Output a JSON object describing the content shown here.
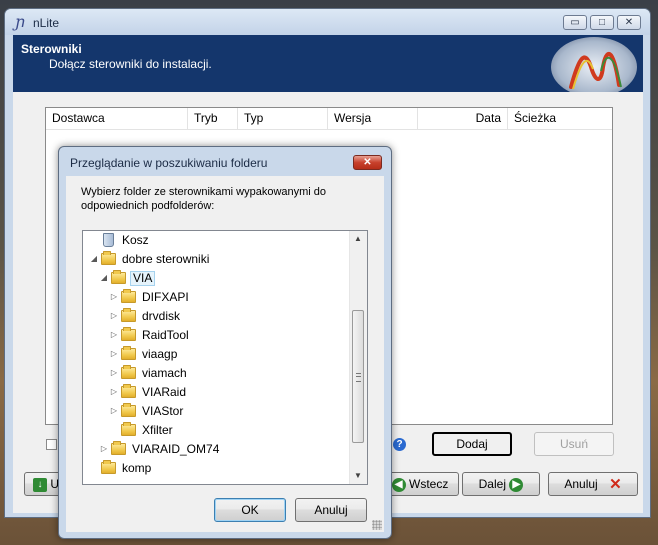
{
  "window": {
    "title": "nLite",
    "app_icon": "nlite-logo-icon",
    "controls": {
      "minimize": "▭",
      "maximize": "□",
      "close": "✕"
    }
  },
  "header": {
    "title": "Sterowniki",
    "subtitle": "Dołącz sterowniki do instalacji."
  },
  "driver_list": {
    "columns": [
      "Dostawca",
      "Tryb",
      "Typ",
      "Wersja",
      "Data",
      "Ścieżka"
    ],
    "rows": []
  },
  "buttons": {
    "add": "Dodaj",
    "remove": "Usuń",
    "help_icon": "?"
  },
  "footer": {
    "left_label": "U",
    "back": "Wstecz",
    "next": "Dalej",
    "cancel": "Anuluj"
  },
  "dialog": {
    "title": "Przeglądanie w poszukiwaniu folderu",
    "close_glyph": "✕",
    "description": "Wybierz folder ze sterownikami wypakowanymi do odpowiednich podfolderów:",
    "tree": [
      {
        "label": "Kosz",
        "icon": "recycle-bin-icon",
        "level": 1,
        "expander": ""
      },
      {
        "label": "dobre sterowniki",
        "icon": "folder-icon",
        "level": 1,
        "expander": "◢"
      },
      {
        "label": "VIA",
        "icon": "folder-icon",
        "level": 2,
        "expander": "◢",
        "selected": true
      },
      {
        "label": "DIFXAPI",
        "icon": "folder-icon",
        "level": 3,
        "expander": "▷"
      },
      {
        "label": "drvdisk",
        "icon": "folder-icon",
        "level": 3,
        "expander": "▷"
      },
      {
        "label": "RaidTool",
        "icon": "folder-icon",
        "level": 3,
        "expander": "▷"
      },
      {
        "label": "viaagp",
        "icon": "folder-icon",
        "level": 3,
        "expander": "▷"
      },
      {
        "label": "viamach",
        "icon": "folder-icon",
        "level": 3,
        "expander": "▷"
      },
      {
        "label": "VIARaid",
        "icon": "folder-icon",
        "level": 3,
        "expander": "▷"
      },
      {
        "label": "VIAStor",
        "icon": "folder-icon",
        "level": 3,
        "expander": "▷"
      },
      {
        "label": "Xfilter",
        "icon": "folder-icon",
        "level": 3,
        "expander": ""
      },
      {
        "label": "VIARAID_OM74",
        "icon": "folder-icon",
        "level": 2,
        "expander": "▷"
      },
      {
        "label": "komp",
        "icon": "folder-icon",
        "level": 1,
        "expander": ""
      }
    ],
    "ok": "OK",
    "cancel": "Anuluj"
  },
  "colors": {
    "header_bg": "#14366c",
    "window_frame": "#c9d8ea",
    "selection_bg": "#e5f3fb"
  }
}
